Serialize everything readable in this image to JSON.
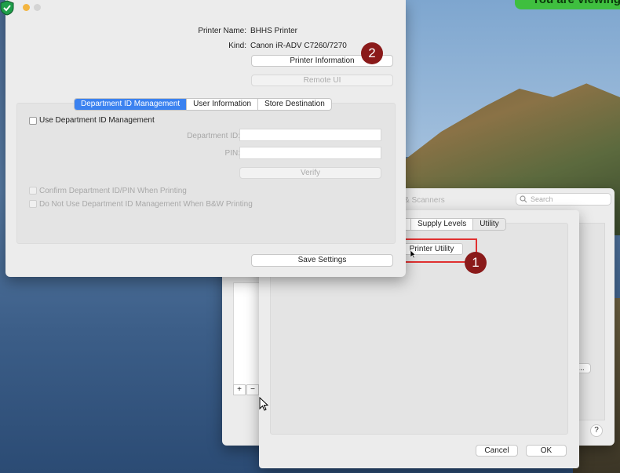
{
  "banner": {
    "text": "You are viewing"
  },
  "printer_window": {
    "printer_name_label": "Printer Name:",
    "printer_name_value": "BHHS Printer",
    "kind_label": "Kind:",
    "kind_value": "Canon iR-ADV C7260/7270",
    "printer_information_button": "Printer Information",
    "remote_ui_button": "Remote UI",
    "tabs": [
      "Department ID Management",
      "User Information",
      "Store Destination"
    ],
    "use_dept_id_checkbox_label": "Use Department ID Management",
    "department_id_label": "Department ID:",
    "department_id_value": "",
    "pin_label": "PIN:",
    "pin_value": "",
    "verify_button": "Verify",
    "confirm_checkbox_label": "Confirm Department ID/PIN When Printing",
    "do_not_use_checkbox_label": "Do Not Use Department ID Management When B&W Printing",
    "save_settings_button": "Save Settings"
  },
  "back_window": {
    "title_fragment": "& Scanners",
    "search_placeholder": "Search",
    "tabs": [
      "Supply Levels",
      "Utility"
    ],
    "printer_utility_button": "Printer Utility",
    "add_button": "+",
    "remove_button": "−",
    "help_button": "?",
    "options_button_fragment": "s...",
    "cancel_button": "Cancel",
    "ok_button": "OK"
  },
  "annotations": {
    "step1": "1",
    "step2": "2"
  },
  "colors": {
    "accent": "#3b82f0",
    "badge": "#8a1a1a",
    "highlight": "#e03030",
    "banner": "#3fbf3f"
  }
}
